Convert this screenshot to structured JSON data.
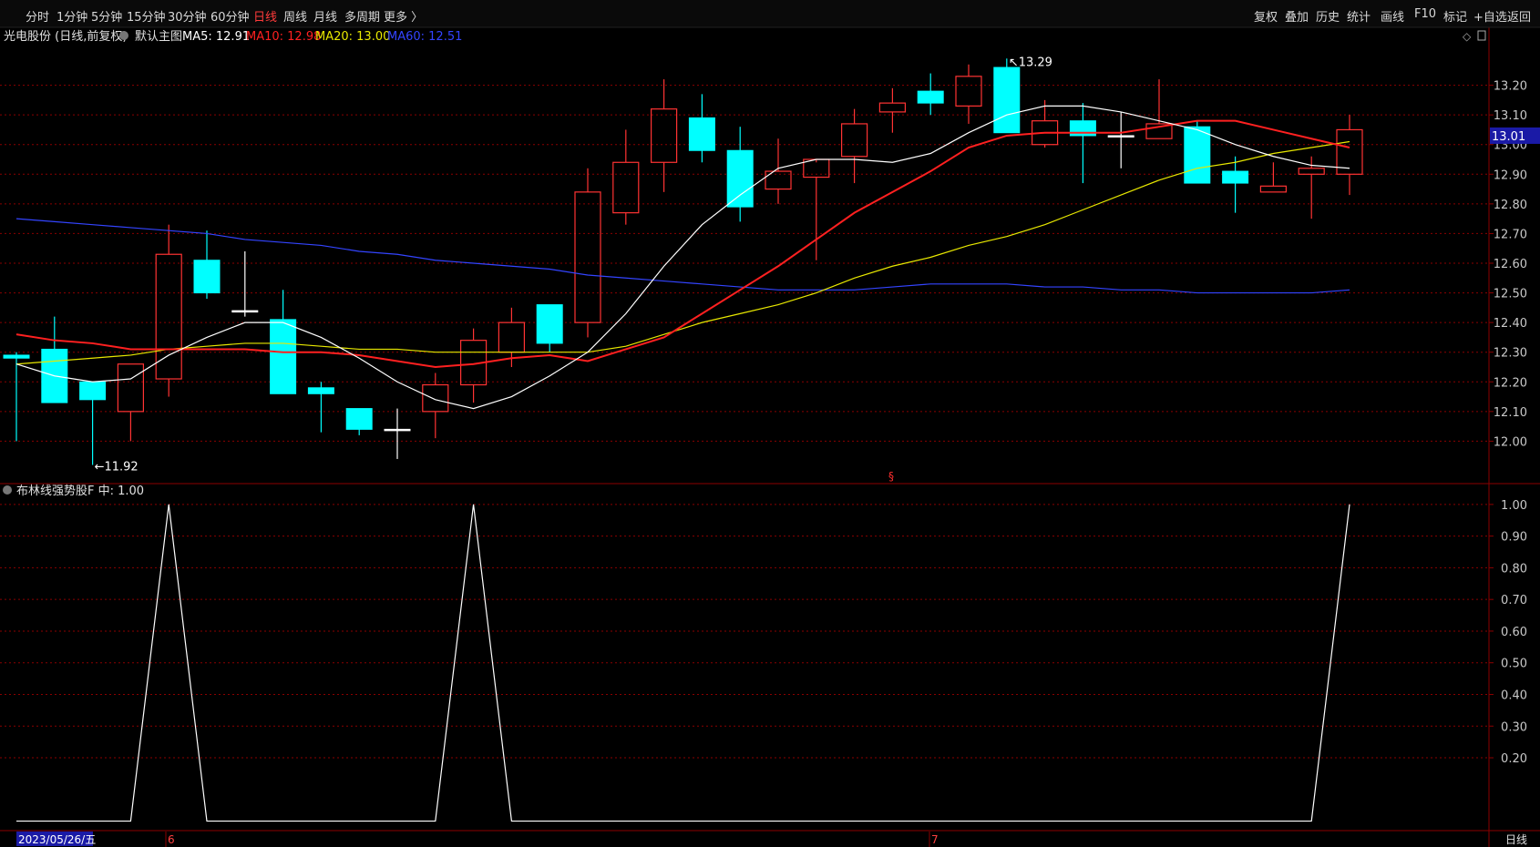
{
  "toolbar": {
    "periods": [
      "分时",
      "1分钟",
      "5分钟",
      "15分钟",
      "30分钟",
      "60分钟",
      "日线",
      "周线",
      "月线",
      "多周期",
      "更多 〉"
    ],
    "active_period": "日线",
    "actions": [
      "复权",
      "叠加",
      "历史",
      "统计",
      "画线",
      "F10",
      "标记",
      "+自选",
      "返回"
    ]
  },
  "main": {
    "stock": "光电股份",
    "mode": "(日线,前复权)",
    "template": "默认主图",
    "ma": [
      {
        "label": "MA5: 12.91",
        "color": "#ffffff"
      },
      {
        "label": "MA10: 12.98",
        "color": "#ff2020"
      },
      {
        "label": "MA20: 13.00",
        "color": "#e8e800"
      },
      {
        "label": "MA60: 12.51",
        "color": "#3344ff"
      }
    ],
    "high_marker": "13.29",
    "low_marker": "11.92",
    "price_tag": "13.01",
    "mid_marker": "§"
  },
  "sub": {
    "indicator": "布林线强势股F",
    "value_label": "中: 1.00"
  },
  "bottom": {
    "date": "2023/05/26/五",
    "month_marks": [
      "6",
      "7"
    ],
    "period_label": "日线"
  },
  "colors": {
    "up": "#ff3333",
    "down": "#00ffff",
    "grid": "#8b0000",
    "axis_text": "#c8c8c8",
    "ma5": "#ffffff",
    "ma10": "#ff2020",
    "ma20": "#e8e800",
    "ma60": "#3344ff",
    "tag_bg": "#1a1aa6"
  },
  "chart_data": {
    "type": "candlestick",
    "main_yticks": [
      13.2,
      13.1,
      13.0,
      12.9,
      12.8,
      12.7,
      12.6,
      12.5,
      12.4,
      12.3,
      12.2,
      12.1,
      12.0
    ],
    "sub_yticks": [
      1.0,
      0.9,
      0.8,
      0.7,
      0.6,
      0.5,
      0.4,
      0.3,
      0.2
    ],
    "main_ylim": [
      11.86,
      13.34
    ],
    "sub_ylim": [
      -0.03,
      1.06
    ],
    "candles": [
      {
        "o": 12.29,
        "h": 12.3,
        "l": 12.0,
        "c": 12.28
      },
      {
        "o": 12.31,
        "h": 12.42,
        "l": 12.13,
        "c": 12.13
      },
      {
        "o": 12.2,
        "h": 12.2,
        "l": 11.92,
        "c": 12.14
      },
      {
        "o": 12.1,
        "h": 12.26,
        "l": 12.0,
        "c": 12.26
      },
      {
        "o": 12.21,
        "h": 12.73,
        "l": 12.15,
        "c": 12.63
      },
      {
        "o": 12.61,
        "h": 12.71,
        "l": 12.48,
        "c": 12.5
      },
      {
        "o": 12.44,
        "h": 12.64,
        "l": 12.42,
        "c": 12.44
      },
      {
        "o": 12.41,
        "h": 12.51,
        "l": 12.16,
        "c": 12.16
      },
      {
        "o": 12.18,
        "h": 12.2,
        "l": 12.03,
        "c": 12.16
      },
      {
        "o": 12.11,
        "h": 12.11,
        "l": 12.02,
        "c": 12.04
      },
      {
        "o": 12.04,
        "h": 12.11,
        "l": 11.94,
        "c": 12.04
      },
      {
        "o": 12.1,
        "h": 12.23,
        "l": 12.01,
        "c": 12.19
      },
      {
        "o": 12.19,
        "h": 12.38,
        "l": 12.13,
        "c": 12.34
      },
      {
        "o": 12.3,
        "h": 12.45,
        "l": 12.25,
        "c": 12.4
      },
      {
        "o": 12.46,
        "h": 12.46,
        "l": 12.3,
        "c": 12.33
      },
      {
        "o": 12.4,
        "h": 12.92,
        "l": 12.35,
        "c": 12.84
      },
      {
        "o": 12.77,
        "h": 13.05,
        "l": 12.73,
        "c": 12.94
      },
      {
        "o": 12.94,
        "h": 13.22,
        "l": 12.84,
        "c": 13.12
      },
      {
        "o": 13.09,
        "h": 13.17,
        "l": 12.94,
        "c": 12.98
      },
      {
        "o": 12.98,
        "h": 13.06,
        "l": 12.74,
        "c": 12.79
      },
      {
        "o": 12.85,
        "h": 13.02,
        "l": 12.8,
        "c": 12.91
      },
      {
        "o": 12.89,
        "h": 12.94,
        "l": 12.61,
        "c": 12.95
      },
      {
        "o": 12.96,
        "h": 13.12,
        "l": 12.87,
        "c": 13.07
      },
      {
        "o": 13.11,
        "h": 13.19,
        "l": 13.04,
        "c": 13.14
      },
      {
        "o": 13.18,
        "h": 13.24,
        "l": 13.1,
        "c": 13.14
      },
      {
        "o": 13.13,
        "h": 13.27,
        "l": 13.07,
        "c": 13.23
      },
      {
        "o": 13.26,
        "h": 13.29,
        "l": 13.04,
        "c": 13.04
      },
      {
        "o": 13.0,
        "h": 13.15,
        "l": 12.99,
        "c": 13.08
      },
      {
        "o": 13.08,
        "h": 13.14,
        "l": 12.87,
        "c": 13.03
      },
      {
        "o": 13.03,
        "h": 13.11,
        "l": 12.92,
        "c": 13.03
      },
      {
        "o": 13.02,
        "h": 13.22,
        "l": 13.02,
        "c": 13.07
      },
      {
        "o": 13.06,
        "h": 13.08,
        "l": 12.87,
        "c": 12.87
      },
      {
        "o": 12.91,
        "h": 12.96,
        "l": 12.77,
        "c": 12.87
      },
      {
        "o": 12.84,
        "h": 12.94,
        "l": 12.84,
        "c": 12.86
      },
      {
        "o": 12.9,
        "h": 12.96,
        "l": 12.75,
        "c": 12.92
      },
      {
        "o": 12.9,
        "h": 13.1,
        "l": 12.83,
        "c": 13.05
      }
    ],
    "ma5": [
      12.26,
      12.22,
      12.2,
      12.21,
      12.29,
      12.35,
      12.4,
      12.4,
      12.35,
      12.28,
      12.2,
      12.14,
      12.11,
      12.15,
      12.22,
      12.3,
      12.43,
      12.59,
      12.73,
      12.83,
      12.92,
      12.95,
      12.95,
      12.94,
      12.97,
      13.04,
      13.1,
      13.13,
      13.13,
      13.11,
      13.08,
      13.05,
      13.0,
      12.96,
      12.93,
      12.92
    ],
    "ma10": [
      12.36,
      12.34,
      12.33,
      12.31,
      12.31,
      12.31,
      12.31,
      12.3,
      12.3,
      12.29,
      12.27,
      12.25,
      12.26,
      12.28,
      12.29,
      12.27,
      12.31,
      12.35,
      12.43,
      12.51,
      12.59,
      12.68,
      12.77,
      12.84,
      12.91,
      12.99,
      13.03,
      13.04,
      13.04,
      13.04,
      13.06,
      13.08,
      13.08,
      13.05,
      13.02,
      12.99
    ],
    "ma20": [
      12.26,
      12.27,
      12.28,
      12.29,
      12.31,
      12.32,
      12.33,
      12.33,
      12.32,
      12.31,
      12.31,
      12.3,
      12.3,
      12.3,
      12.3,
      12.3,
      12.32,
      12.36,
      12.4,
      12.43,
      12.46,
      12.5,
      12.55,
      12.59,
      12.62,
      12.66,
      12.69,
      12.73,
      12.78,
      12.83,
      12.88,
      12.92,
      12.94,
      12.97,
      12.99,
      13.01
    ],
    "ma60": [
      12.75,
      12.74,
      12.73,
      12.72,
      12.71,
      12.7,
      12.68,
      12.67,
      12.66,
      12.64,
      12.63,
      12.61,
      12.6,
      12.59,
      12.58,
      12.56,
      12.55,
      12.54,
      12.53,
      12.52,
      12.51,
      12.51,
      12.51,
      12.52,
      12.53,
      12.53,
      12.53,
      12.52,
      12.52,
      12.51,
      12.51,
      12.5,
      12.5,
      12.5,
      12.5,
      12.51
    ],
    "indicator": [
      0,
      0,
      0,
      0,
      1,
      0,
      0,
      0,
      0,
      0,
      0,
      0,
      1,
      0,
      0,
      0,
      0,
      0,
      0,
      0,
      0,
      0,
      0,
      0,
      0,
      0,
      0,
      0,
      0,
      0,
      0,
      0,
      0,
      0,
      0,
      1
    ]
  }
}
